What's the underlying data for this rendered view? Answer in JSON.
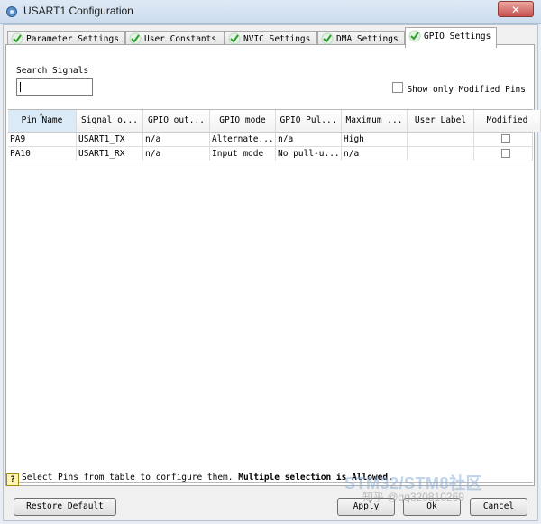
{
  "window": {
    "title": "USART1 Configuration",
    "close_label": "✕"
  },
  "tabs": [
    {
      "label": "Parameter Settings",
      "active": false
    },
    {
      "label": "User Constants",
      "active": false
    },
    {
      "label": "NVIC Settings",
      "active": false
    },
    {
      "label": "DMA Settings",
      "active": false
    },
    {
      "label": "GPIO Settings",
      "active": true
    }
  ],
  "search": {
    "label": "Search Signals",
    "value": ""
  },
  "show_modified": {
    "label": "Show only Modified Pins",
    "checked": false
  },
  "table": {
    "columns": [
      "Pin Name",
      "Signal o...",
      "GPIO out...",
      "GPIO mode",
      "GPIO Pul...",
      "Maximum ...",
      "User Label",
      "Modified"
    ],
    "rows": [
      [
        "PA9",
        "USART1_TX",
        "n/a",
        "Alternate...",
        "n/a",
        "High",
        "",
        false
      ],
      [
        "PA10",
        "USART1_RX",
        "n/a",
        "Input mode",
        "No pull-u...",
        "n/a",
        "",
        false
      ]
    ]
  },
  "hint": {
    "icon": "?",
    "text": "Select Pins from table to configure them. ",
    "bold": "Multiple selection is Allowed."
  },
  "buttons": {
    "restore": "Restore Default",
    "apply": "Apply",
    "ok": "Ok",
    "cancel": "Cancel"
  },
  "watermark": {
    "line1": "STM32/STM8社区",
    "line2": "知乎 @qq320810269"
  },
  "colors": {
    "accent_check": "#2e9d2e",
    "sorted_header": "#dbeaf7",
    "close_red": "#c75050"
  }
}
